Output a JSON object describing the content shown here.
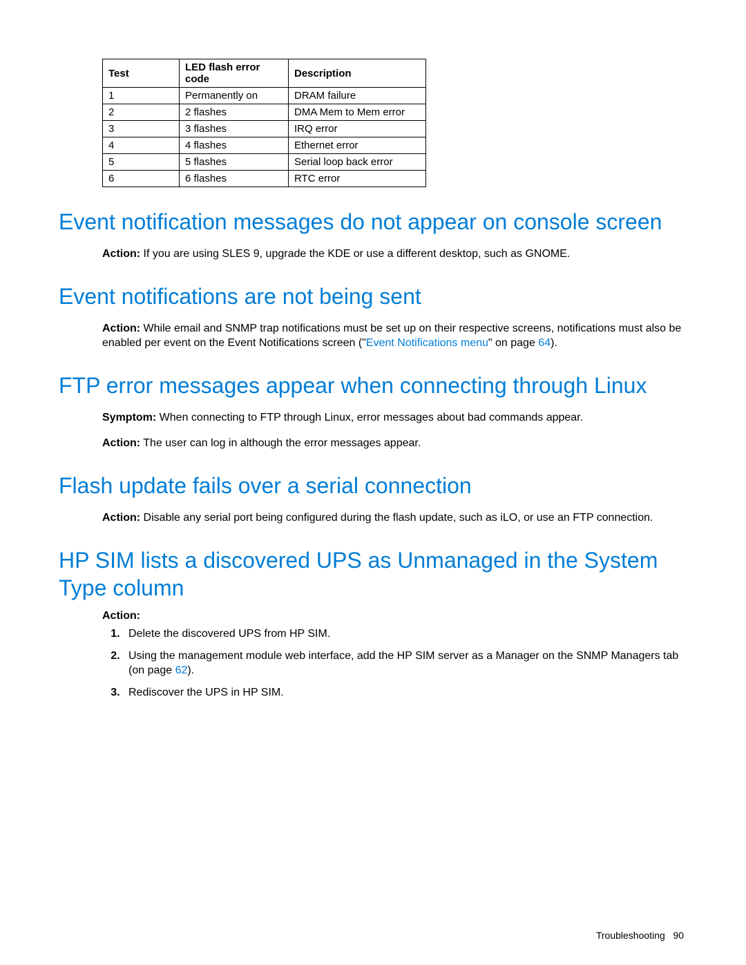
{
  "table": {
    "headers": [
      "Test",
      "LED flash error code",
      "Description"
    ],
    "rows": [
      [
        "1",
        "Permanently on",
        "DRAM failure"
      ],
      [
        "2",
        "2 flashes",
        "DMA Mem to Mem error"
      ],
      [
        "3",
        "3 flashes",
        "IRQ error"
      ],
      [
        "4",
        "4 flashes",
        "Ethernet error"
      ],
      [
        "5",
        "5 flashes",
        "Serial loop back error"
      ],
      [
        "6",
        "6 flashes",
        "RTC error"
      ]
    ]
  },
  "sections": {
    "s1": {
      "heading": "Event notification messages do not appear on console screen",
      "action_label": "Action:",
      "action_text": " If you are using SLES 9, upgrade the KDE or use a different desktop, such as GNOME."
    },
    "s2": {
      "heading": "Event notifications are not being sent",
      "action_label": "Action:",
      "action_text_a": "  While email and SNMP trap notifications must be set up on their respective screens, notifications must also be enabled per event on the Event Notifications screen (\"",
      "link_text": "Event Notifications menu",
      "action_text_b": "\" on page ",
      "page_link": "64",
      "action_text_c": ")."
    },
    "s3": {
      "heading": "FTP error messages appear when connecting through Linux",
      "symptom_label": "Symptom:",
      "symptom_text": " When connecting to FTP through Linux, error messages about bad commands appear.",
      "action_label": "Action:",
      "action_text": " The user can log in although the error messages appear."
    },
    "s4": {
      "heading": "Flash update fails over a serial connection",
      "action_label": "Action:",
      "action_text": " Disable any serial port being configured during the flash update, such as iLO, or use an FTP connection."
    },
    "s5": {
      "heading": "HP SIM lists a discovered UPS as Unmanaged in the System Type column",
      "action_label": "Action:",
      "item1": "Delete the discovered UPS from HP SIM.",
      "item2a": "Using the management module web interface, add the HP SIM server as a Manager on the SNMP Managers tab (on page ",
      "item2_link": "62",
      "item2b": ").",
      "item3": "Rediscover the UPS in HP SIM."
    }
  },
  "footer": {
    "section": "Troubleshooting",
    "page": "90"
  }
}
